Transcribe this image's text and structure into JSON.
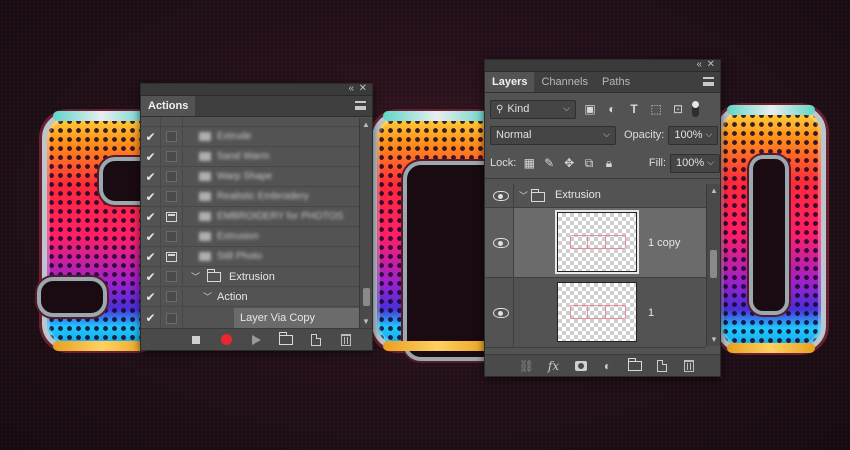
{
  "actions_panel": {
    "tab_label": "Actions",
    "rows": [
      {
        "checked": true,
        "dialog": false,
        "label": "Extrude",
        "blurred": true
      },
      {
        "checked": true,
        "dialog": false,
        "label": "Sand Warm",
        "blurred": true
      },
      {
        "checked": true,
        "dialog": false,
        "label": "Warp Shape",
        "blurred": true
      },
      {
        "checked": true,
        "dialog": false,
        "label": "Realistic Embroidery",
        "blurred": true
      },
      {
        "checked": true,
        "dialog": true,
        "label": "EMBROIDERY for PHOTOS",
        "blurred": true
      },
      {
        "checked": true,
        "dialog": false,
        "label": "Extrusion",
        "blurred": true
      },
      {
        "checked": true,
        "dialog": true,
        "label": "Still Photo",
        "blurred": true
      },
      {
        "checked": true,
        "dialog": false,
        "label": "Extrusion",
        "blurred": false
      },
      {
        "checked": true,
        "dialog": false,
        "label": "Action",
        "blurred": false
      },
      {
        "checked": true,
        "dialog": false,
        "label": "Layer Via Copy",
        "blurred": false
      }
    ]
  },
  "layers_panel": {
    "tabs": [
      "Layers",
      "Channels",
      "Paths"
    ],
    "active_tab": "Layers",
    "filter_kind": "Kind",
    "blend_mode": "Normal",
    "opacity_label": "Opacity:",
    "opacity_value": "100%",
    "lock_label": "Lock:",
    "fill_label": "Fill:",
    "fill_value": "100%",
    "group_name": "Extrusion",
    "layers": [
      {
        "name": "1 copy",
        "selected": true
      },
      {
        "name": "1",
        "selected": false
      }
    ],
    "fx_label": "fx"
  },
  "colors": {
    "panel_bg": "#535353",
    "record_red": "#e8282e",
    "selected_row": "#6b6b6b"
  }
}
